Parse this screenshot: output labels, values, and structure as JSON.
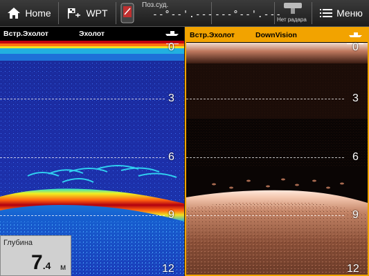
{
  "topbar": {
    "home_label": "Home",
    "wpt_label": "WPT",
    "position_label": "Поз.суд.",
    "lat_value": "--°--'.---",
    "lon_value": "---°--'.---",
    "radar_label": "Нет радара",
    "menu_label": "Меню"
  },
  "left_panel": {
    "source_label": "Встр.Эхолот",
    "mode_label": "Эхолот",
    "depth_scale": [
      "0",
      "3",
      "6",
      "9",
      "12"
    ],
    "depth_box": {
      "title": "Глубина",
      "value": "7",
      "decimal": ".4",
      "unit": "м"
    }
  },
  "right_panel": {
    "source_label": "Встр.Эхолот",
    "mode_label": "DownVision",
    "depth_scale": [
      "0",
      "3",
      "6",
      "9",
      "12"
    ]
  },
  "colors": {
    "accent": "#f2a300",
    "topbar": "#2a2a2a"
  },
  "icons": [
    "home-icon",
    "waypoint-flag-icon",
    "gps-device-icon",
    "radar-icon",
    "menu-icon",
    "boat-icon"
  ]
}
